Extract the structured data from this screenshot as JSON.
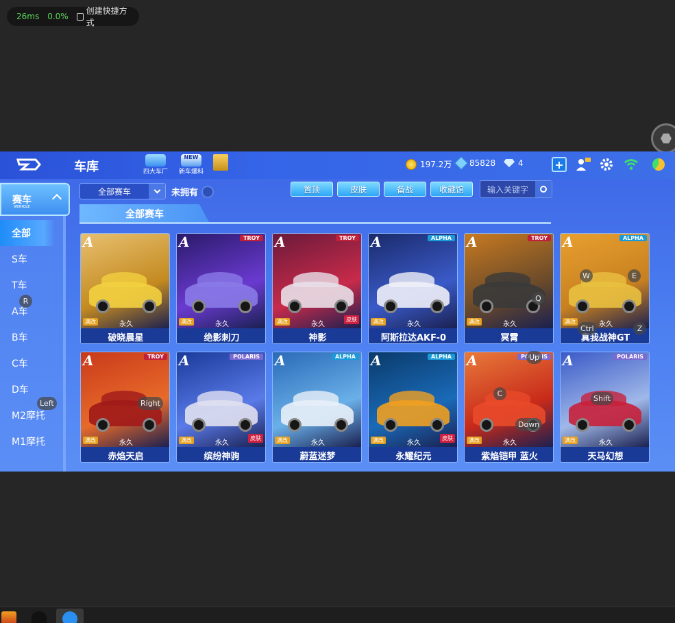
{
  "status": {
    "latency": "26ms",
    "percent": "0.0%",
    "shortcut_label": "创建快捷方式"
  },
  "header": {
    "title": "车库",
    "icons": [
      {
        "label": "四大车厂",
        "icon": "car-factory-icon"
      },
      {
        "label": "新车爆料",
        "icon": "new-car-icon"
      },
      {
        "label": "",
        "icon": "gift-icon"
      }
    ],
    "coins": "197.2万",
    "points": "85828",
    "diamonds": "4"
  },
  "sidebar": {
    "category": "赛车",
    "category_sub": "VEHICLE",
    "items": [
      "全部",
      "S车",
      "T车",
      "A车",
      "B车",
      "C车",
      "D车",
      "M2摩托",
      "M1摩托"
    ],
    "active_index": 0
  },
  "filters": {
    "dropdown_value": "全部赛车",
    "owned_label": "未拥有",
    "buttons": [
      "置顶",
      "皮肤",
      "备战",
      "收藏馆"
    ],
    "search_placeholder": "输入关键字"
  },
  "section_title": "全部赛车",
  "cards": [
    {
      "name": "破晓晨星",
      "brand": "",
      "tag1": "满改",
      "tag2": "永久",
      "tag3": "",
      "colors": [
        "#e8c070",
        "#c48a20",
        "#f2d040"
      ]
    },
    {
      "name": "绝影刺刀",
      "brand": "TROY",
      "tag1": "满改",
      "tag2": "永久",
      "tag3": "",
      "colors": [
        "#2a1a6a",
        "#6a3ad0",
        "#8a7ae8"
      ]
    },
    {
      "name": "神影",
      "brand": "TROY",
      "tag1": "满改",
      "tag2": "永久",
      "tag3": "皮肤",
      "colors": [
        "#6a1a3a",
        "#c82a4a",
        "#e8e0e8"
      ]
    },
    {
      "name": "阿斯拉达AKF-0",
      "brand": "ALPHA",
      "tag1": "满改",
      "tag2": "永久",
      "tag3": "",
      "colors": [
        "#1a2a6a",
        "#3a5ac8",
        "#f0f0f8"
      ]
    },
    {
      "name": "冥霄",
      "brand": "TROY",
      "tag1": "满改",
      "tag2": "永久",
      "tag3": "",
      "colors": [
        "#c87a20",
        "#6a4a2a",
        "#3a3a3a"
      ]
    },
    {
      "name": "真我战神GT",
      "brand": "ALPHA",
      "tag1": "满改",
      "tag2": "永久",
      "tag3": "",
      "colors": [
        "#e8a030",
        "#c88020",
        "#e8c040"
      ]
    },
    {
      "name": "赤焰天启",
      "brand": "TROY",
      "tag1": "满改",
      "tag2": "永久",
      "tag3": "",
      "colors": [
        "#c83a1a",
        "#e86a2a",
        "#a01a1a"
      ]
    },
    {
      "name": "缤纷神驹",
      "brand": "POLARIS",
      "tag1": "满改",
      "tag2": "永久",
      "tag3": "皮肤",
      "colors": [
        "#1a3a9a",
        "#5a7ae8",
        "#e0e0f0"
      ]
    },
    {
      "name": "蔚蓝迷梦",
      "brand": "ALPHA",
      "tag1": "满改",
      "tag2": "永久",
      "tag3": "",
      "colors": [
        "#2a6ab8",
        "#6ab0e8",
        "#e8f0f8"
      ]
    },
    {
      "name": "永耀纪元",
      "brand": "ALPHA",
      "tag1": "满改",
      "tag2": "永久",
      "tag3": "皮肤",
      "colors": [
        "#0a3a6a",
        "#1a6ab8",
        "#f0a020"
      ]
    },
    {
      "name": "紫焰铠甲 蓝火",
      "brand": "POLARIS",
      "tag1": "满改",
      "tag2": "永久",
      "tag3": "",
      "colors": [
        "#e87a3a",
        "#c82a1a",
        "#e84a2a"
      ]
    },
    {
      "name": "天马幻想",
      "brand": "POLARIS",
      "tag1": "满改",
      "tag2": "永久",
      "tag3": "",
      "colors": [
        "#3a5ac8",
        "#a0b8e8",
        "#c8203a"
      ]
    }
  ],
  "key_overlays": [
    "R",
    "Left",
    "Right",
    "W",
    "E",
    "Q",
    "Ctrl",
    "Z",
    "Up",
    "C",
    "Down",
    "Shift"
  ]
}
